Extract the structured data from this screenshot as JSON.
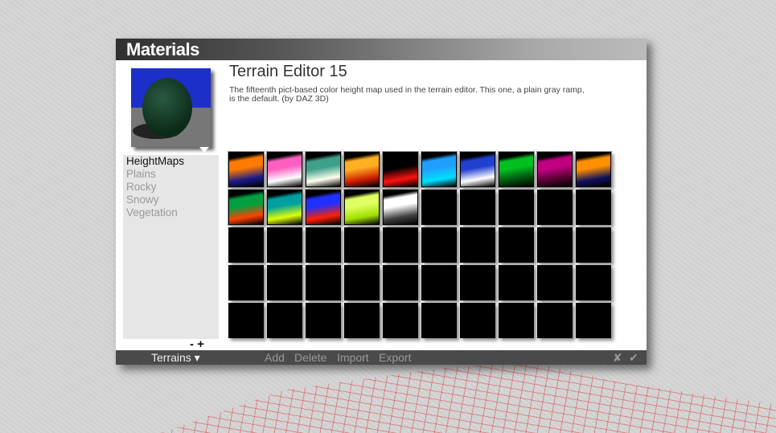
{
  "panel": {
    "title": "Materials"
  },
  "material": {
    "name": "Terrain Editor 15",
    "description": "The fifteenth pict-based color height map used in the terrain editor.  This one, a plain gray ramp, is the default. (by DAZ 3D)"
  },
  "categories": [
    {
      "label": "HeightMaps",
      "selected": true
    },
    {
      "label": "Plains"
    },
    {
      "label": "Rocky"
    },
    {
      "label": "Snowy"
    },
    {
      "label": "Vegetation"
    }
  ],
  "list_controls": {
    "minus": "-",
    "plus": "+"
  },
  "thumbnails": [
    [
      "#ff7a00",
      "#1a1a8a"
    ],
    [
      "#ff5fc0",
      "#ffffff"
    ],
    [
      "#3fa08a",
      "#ffffee"
    ],
    [
      "#ffb020",
      "#d02000"
    ],
    [
      "#000000",
      "#ff1010"
    ],
    [
      "#1fa0ff",
      "#00e0ff"
    ],
    [
      "#2040d0",
      "#ffffff"
    ],
    [
      "#00c020",
      "#005010"
    ],
    [
      "#c00080",
      "#500030"
    ],
    [
      "#ff9000",
      "#101060"
    ],
    [
      "#00a040",
      "#ff4000"
    ],
    [
      "#00a0a0",
      "#e0ff00"
    ],
    [
      "#2030ff",
      "#ff2000"
    ],
    [
      "#e0ff60",
      "#a0e000"
    ],
    [
      "#ffffff",
      "#404040"
    ]
  ],
  "grid": {
    "total_cells": 50
  },
  "bottom": {
    "library": "Terrains",
    "add": "Add",
    "delete": "Delete",
    "import": "Import",
    "export": "Export",
    "cancel": "✘",
    "ok": "✔"
  }
}
